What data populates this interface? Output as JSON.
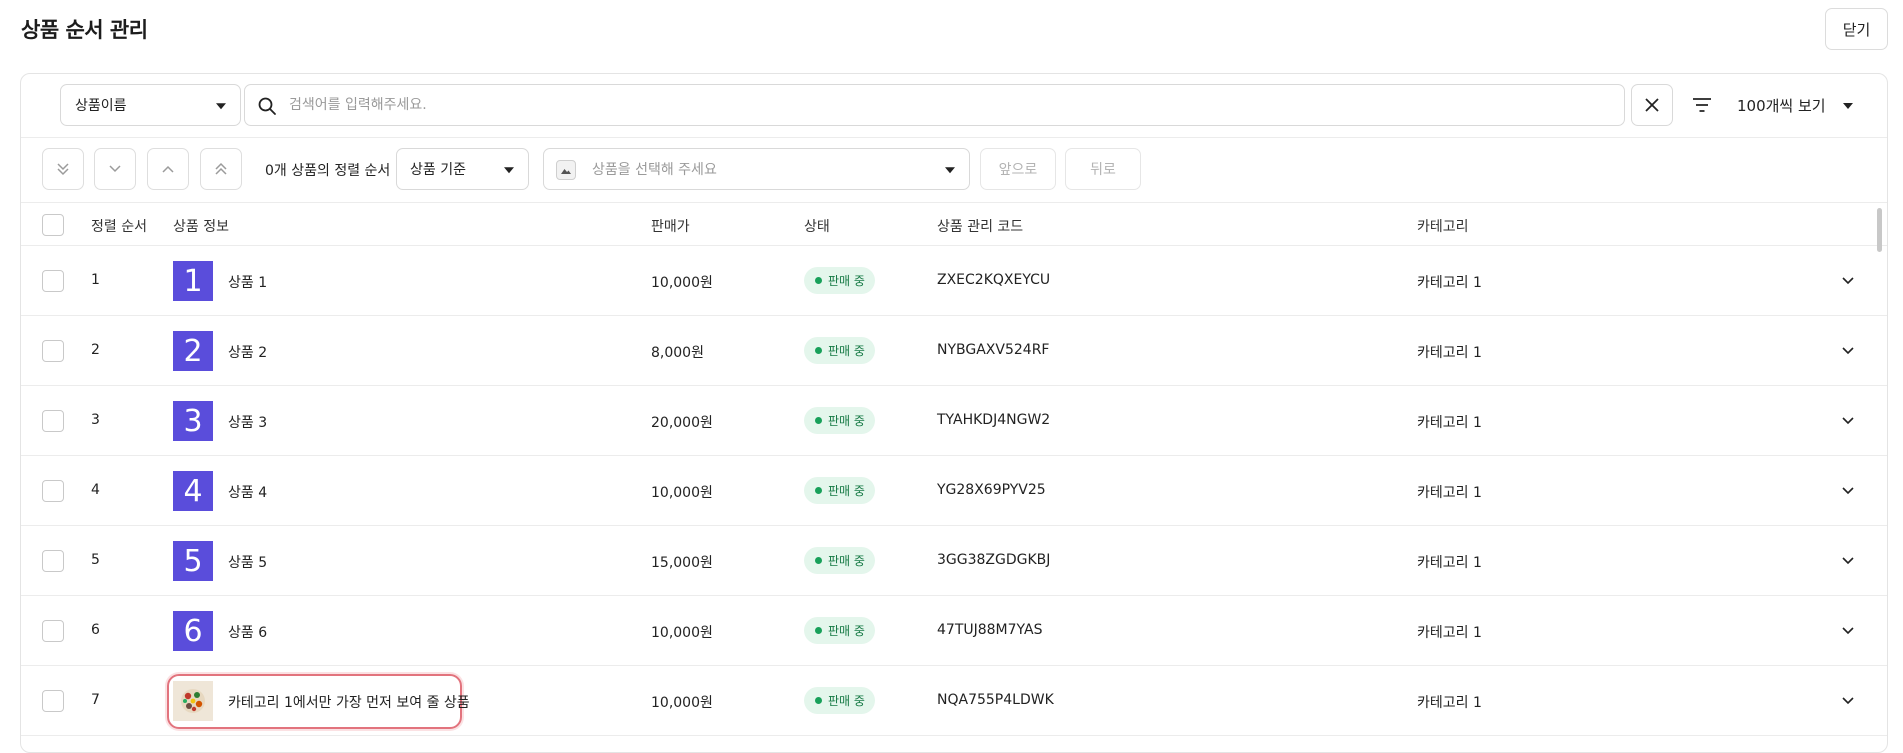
{
  "page": {
    "title": "상품 순서 관리",
    "close_label": "닫기"
  },
  "search": {
    "field_select": "상품이름",
    "placeholder": "검색어를 입력해주세요.",
    "page_size": "100개씩 보기"
  },
  "sort": {
    "count_text": "0개 상품의 정렬 순서",
    "basis": "상품 기준",
    "product_placeholder": "상품을 선택해 주세요",
    "front_label": "앞으로",
    "back_label": "뒤로"
  },
  "table": {
    "headers": [
      "정렬 순서",
      "상품 정보",
      "판매가",
      "상태",
      "상품 관리 코드",
      "카테고리"
    ],
    "rows": [
      {
        "order": "1",
        "thumb": "1",
        "name": "상품 1",
        "price": "10,000원",
        "status": "판매 중",
        "code": "ZXEC2KQXEYCU",
        "category": "카테고리 1"
      },
      {
        "order": "2",
        "thumb": "2",
        "name": "상품 2",
        "price": "8,000원",
        "status": "판매 중",
        "code": "NYBGAXV524RF",
        "category": "카테고리 1"
      },
      {
        "order": "3",
        "thumb": "3",
        "name": "상품 3",
        "price": "20,000원",
        "status": "판매 중",
        "code": "TYAHKDJ4NGW2",
        "category": "카테고리 1"
      },
      {
        "order": "4",
        "thumb": "4",
        "name": "상품 4",
        "price": "10,000원",
        "status": "판매 중",
        "code": "YG28X69PYV25",
        "category": "카테고리 1"
      },
      {
        "order": "5",
        "thumb": "5",
        "name": "상품 5",
        "price": "15,000원",
        "status": "판매 중",
        "code": "3GG38ZGDGKBJ",
        "category": "카테고리 1"
      },
      {
        "order": "6",
        "thumb": "6",
        "name": "상품 6",
        "price": "10,000원",
        "status": "판매 중",
        "code": "47TUJ88M7YAS",
        "category": "카테고리 1"
      },
      {
        "order": "7",
        "thumb": "",
        "name": "카테고리 1에서만 가장 먼저 보여 줄 상품",
        "price": "10,000원",
        "status": "판매 중",
        "code": "NQA755P4LDWK",
        "category": "카테고리 1"
      }
    ]
  },
  "colors": {
    "thumb_bg": "#5a4ddb",
    "status_bg": "#e4f6ec",
    "status_dot": "#18a05a",
    "highlight": "#e2737d"
  }
}
